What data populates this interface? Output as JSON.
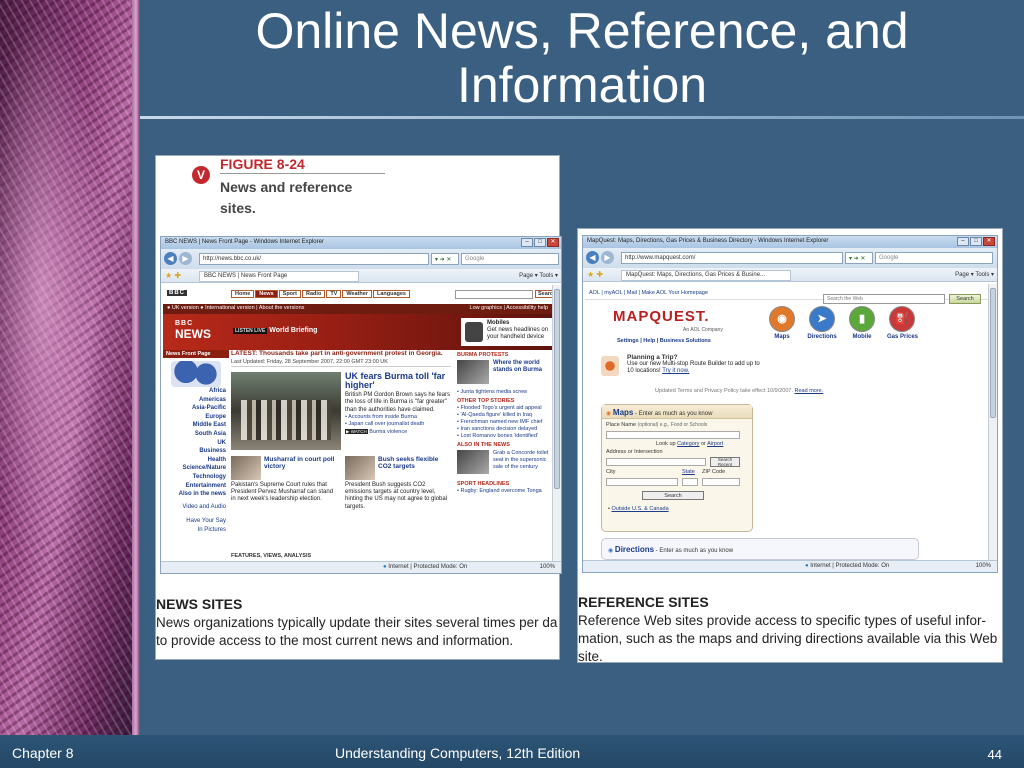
{
  "slide": {
    "title_line1": "Online News, Reference, and",
    "title_line2": "Information",
    "footer_left": "Chapter 8",
    "footer_center": "Understanding Computers, 12th Edition",
    "footer_page": "44"
  },
  "figure": {
    "logo_letter": "V",
    "number": "FIGURE 8-24",
    "caption": "News and reference sites."
  },
  "news_caption": {
    "heading": "NEWS SITES",
    "body": "News organizations typically update their sites several times per da to provide access to the most current news and information."
  },
  "ref_caption": {
    "heading": "REFERENCE SITES",
    "body": "Reference Web sites provide access to specific types of useful infor- mation, such as the maps and driving directions available via this Web site."
  },
  "bbc_browser": {
    "window_title": "BBC NEWS | News Front Page - Windows Internet Explorer",
    "url": "http://news.bbc.co.uk/",
    "search_placeholder": "Google",
    "tab_label": "BBC NEWS | News Front Page",
    "tools_label": "Page ▾  Tools ▾",
    "status": "Internet | Protected Mode: On",
    "zoom": "100%",
    "logo_small": "BBC",
    "nav": [
      "Home",
      "News",
      "Sport",
      "Radio",
      "TV",
      "Weather",
      "Languages"
    ],
    "nav_active": "News",
    "search_button": "Search",
    "version_bar": "● UK version  ● International version | About the versions",
    "version_right": "Low graphics | Accessibility help",
    "logo_bbc": "BBC",
    "logo_news": "NEWS",
    "world_tag": "LISTEN LIVE",
    "world_label": "World Briefing",
    "mobile_title": "Mobiles",
    "mobile_text": "Get news headlines on your handheld device",
    "side_header": "News Front Page",
    "regions": [
      "Africa",
      "Americas",
      "Asia-Pacific",
      "Europe",
      "Middle East",
      "South Asia",
      "UK",
      "Business",
      "Health",
      "Science/Nature",
      "Technology",
      "Entertainment",
      "Also in the news"
    ],
    "side_extra": [
      "Video and Audio",
      "Have Your Say",
      "In Pictures"
    ],
    "latest": "LATEST: Thousands take part in anti-government protest in Georgia.",
    "updated": "Last Updated: Friday, 28 September 2007, 22:00 GMT 23:00 UK",
    "lead_headline": "UK fears Burma toll 'far higher'",
    "lead_text": "British PM Gordon Brown says he fears the loss of life in Burma is \"far greater\" than the authorities have claimed.",
    "lead_links": [
      "Accounts from inside Burma",
      "Japan call over journalist death",
      "Burma violence"
    ],
    "story2_headline": "Musharraf in court poll victory",
    "story2_text": "Pakistan's Supreme Court rules that President Pervez Musharraf can stand in next week's leadership election.",
    "story3_headline": "Bush seeks flexible CO2 targets",
    "story3_text": "President Bush suggests CO2 emissions targets at country level, hinting the US may not agree to global targets.",
    "features_label": "FEATURES, VIEWS, ANALYSIS",
    "right_sec1": "BURMA PROTESTS",
    "right_feat1": "Where the world stands on Burma",
    "right_link1": "Junta tightens media screw",
    "right_sec2": "OTHER TOP STORIES",
    "right_links2": [
      "Flooded Togo's urgent aid appeal",
      "'Al-Qaeda figure' killed in Iraq",
      "Frenchman named new IMF chief",
      "Iran sanctions decision delayed",
      "Lost Romanov bones 'identified'"
    ],
    "right_sec3": "ALSO IN THE NEWS",
    "right_feat3": "Grab a Concorde toilet seat in the supersonic sale of the century",
    "right_sec4": "SPORT HEADLINES",
    "right_link4": "Rugby: England overcome Tonga"
  },
  "mq_browser": {
    "window_title": "MapQuest: Maps, Directions, Gas Prices & Business Directory - Windows Internet Explorer",
    "url": "http://www.mapquest.com/",
    "search_placeholder": "Google",
    "tab_label": "MapQuest: Maps, Directions, Gas Prices & Busine...",
    "tools_label": "Page ▾  Tools ▾",
    "status": "Internet | Protected Mode: On",
    "zoom": "100%",
    "aol_links": "AOL | myAOL | Mail | Make AOL Your Homepage",
    "web_search_placeholder": "Search the Web",
    "search_button": "Search",
    "logo": "MAPQUEST.",
    "aol_company": "An AOL Company",
    "sublinks": "Settings | Help | Business Solutions",
    "icons": [
      {
        "label": "Maps",
        "icon": "globe-icon",
        "color": "#e07a2a",
        "glyph": "◉"
      },
      {
        "label": "Directions",
        "icon": "car-icon",
        "color": "#3a7ac8",
        "glyph": "➤"
      },
      {
        "label": "Mobile",
        "icon": "phone-icon",
        "color": "#5aa83a",
        "glyph": "▮"
      },
      {
        "label": "Gas Prices",
        "icon": "gas-pump-icon",
        "color": "#c83a3a",
        "glyph": "⛽"
      }
    ],
    "plan_title": "Planning a Trip?",
    "plan_text": "Use our new Multi-stop Route Builder to add up to 10 locations!",
    "plan_link": "Try it now.",
    "updated_text": "Updated Terms and Privacy Policy take effect 10/9/2007.",
    "updated_link": "Read more.",
    "maps_title": "Maps",
    "maps_sub": "- Enter as much as you know",
    "place_label": "Place Name",
    "place_hint": "(optional) e.g., Food or Schools",
    "lookup": "Look up",
    "lookup_cat": "Category",
    "lookup_or": "or",
    "lookup_airport": "Airport",
    "address_label": "Address or Intersection",
    "search_nearby": "Search Recent",
    "city_label": "City",
    "state_label": "State",
    "zip_label": "ZIP Code",
    "maps_search_btn": "Search",
    "outside_link": "Outside U.S. & Canada",
    "directions_title": "Directions",
    "directions_sub": "- Enter as much as you know"
  }
}
